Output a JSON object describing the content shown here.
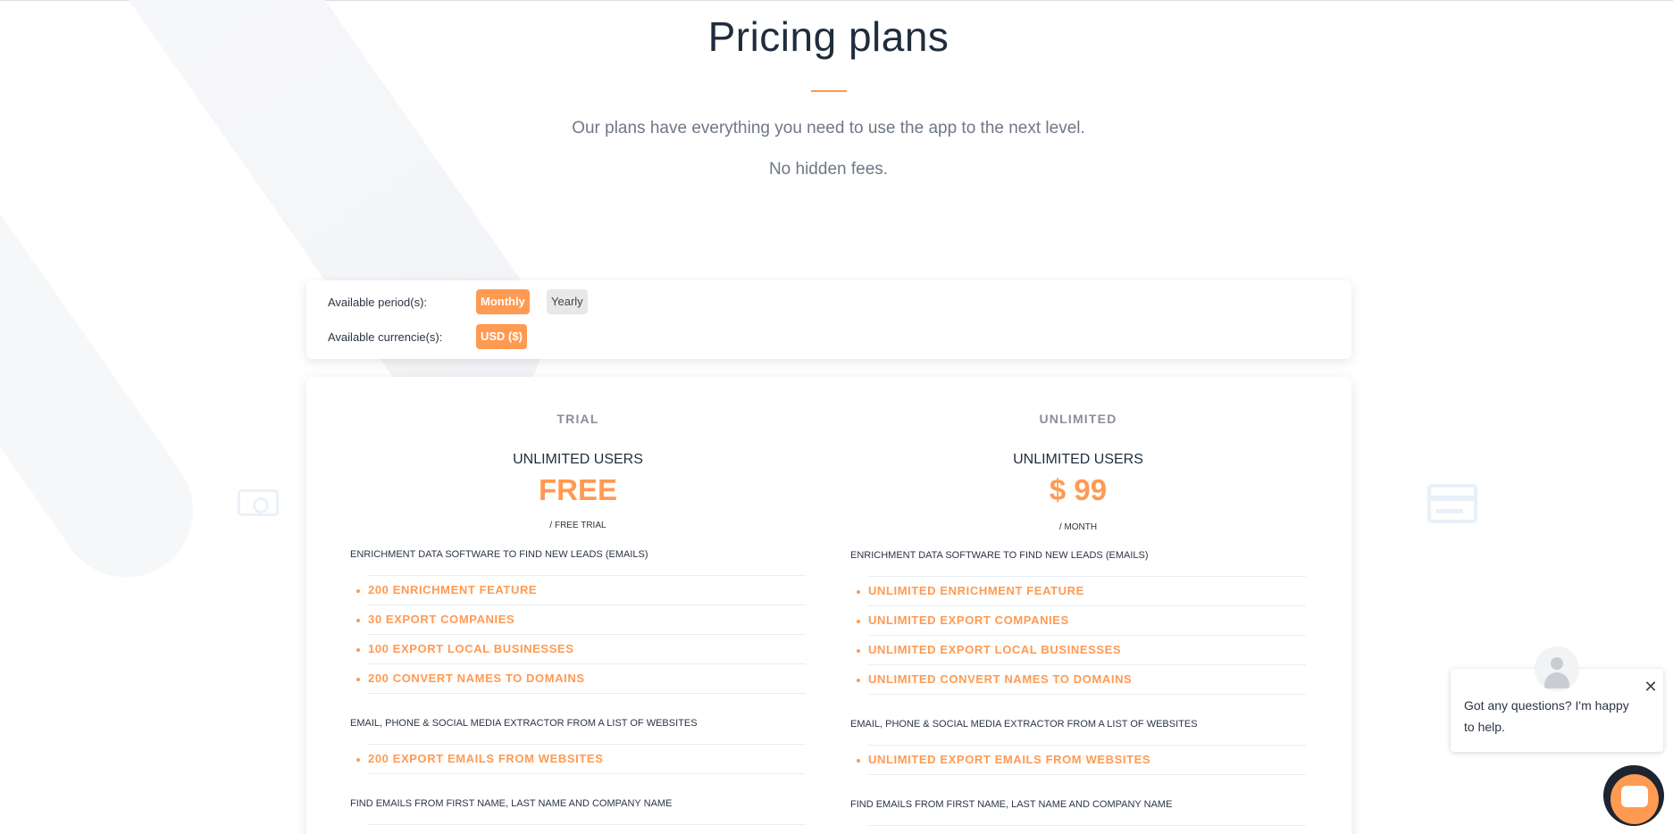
{
  "header": {
    "title": "Pricing plans",
    "subtitle": "Our plans have everything you need to use the app to the next level.",
    "subtitle2": "No hidden fees."
  },
  "options": {
    "period_label": "Available period(s):",
    "currency_label": "Available currencie(s):",
    "periods": [
      "Monthly",
      "Yearly"
    ],
    "selected_period": "Monthly",
    "currency": "USD ($)"
  },
  "plans": [
    {
      "name": "TRIAL",
      "users": "UNLIMITED USERS",
      "price": "FREE",
      "period": "/ FREE TRIAL",
      "sections": [
        {
          "heading": "ENRICHMENT DATA SOFTWARE TO FIND NEW LEADS (EMAILS)",
          "features": [
            "200 ENRICHMENT FEATURE",
            "30 EXPORT COMPANIES",
            "100 EXPORT LOCAL BUSINESSES",
            "200 CONVERT NAMES TO DOMAINS"
          ]
        },
        {
          "heading": "EMAIL, PHONE & SOCIAL MEDIA EXTRACTOR FROM A LIST OF WEBSITES",
          "features": [
            "200 EXPORT EMAILS FROM WEBSITES"
          ]
        },
        {
          "heading": "FIND EMAILS FROM FIRST NAME, LAST NAME AND COMPANY NAME",
          "features": []
        }
      ]
    },
    {
      "name": "UNLIMITED",
      "users": "UNLIMITED USERS",
      "price": "$ 99",
      "period": "/ MONTH",
      "sections": [
        {
          "heading": "ENRICHMENT DATA SOFTWARE TO FIND NEW LEADS (EMAILS)",
          "features": [
            "UNLIMITED ENRICHMENT FEATURE",
            "UNLIMITED EXPORT COMPANIES",
            "UNLIMITED EXPORT LOCAL BUSINESSES",
            "UNLIMITED CONVERT NAMES TO DOMAINS"
          ]
        },
        {
          "heading": "EMAIL, PHONE & SOCIAL MEDIA EXTRACTOR FROM A LIST OF WEBSITES",
          "features": [
            "UNLIMITED EXPORT EMAILS FROM WEBSITES"
          ]
        },
        {
          "heading": "FIND EMAILS FROM FIRST NAME, LAST NAME AND COMPANY NAME",
          "features": []
        }
      ]
    }
  ],
  "chat": {
    "message": "Got any questions? I'm happy to help.",
    "close_icon": "close-icon",
    "avatar_icon": "user-avatar-icon",
    "launcher_icon": "chat-bubble-icon"
  },
  "colors": {
    "accent": "#ff9a52",
    "text": "#1f2d3d",
    "muted": "#6f7786"
  }
}
